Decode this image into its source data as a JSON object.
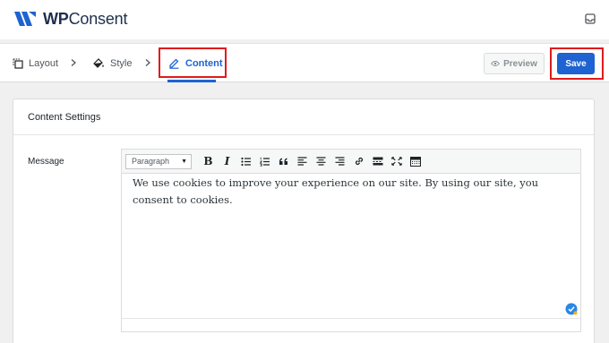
{
  "brand": {
    "name_bold": "WP",
    "name_regular": "Consent",
    "logo_color": "#1e63d1"
  },
  "header": {
    "icon": "inbox-icon"
  },
  "wizard": {
    "steps": [
      {
        "label": "Layout",
        "icon": "layout-icon"
      },
      {
        "label": "Style",
        "icon": "paint-bucket-icon"
      },
      {
        "label": "Content",
        "icon": "pencil-icon",
        "active": true
      }
    ],
    "preview_label": "Preview",
    "save_label": "Save"
  },
  "panel": {
    "title": "Content Settings",
    "message_label": "Message"
  },
  "editor": {
    "format_select": "Paragraph",
    "toolbar_icons": [
      "bold-icon",
      "italic-icon",
      "bulleted-list-icon",
      "numbered-list-icon",
      "blockquote-icon",
      "align-left-icon",
      "align-center-icon",
      "align-right-icon",
      "link-icon",
      "read-more-icon",
      "fullscreen-icon",
      "toolbar-toggle-icon"
    ],
    "content_line1": "We use cookies to improve your experience on our site. By using our site, you",
    "content_line2": "consent to cookies."
  },
  "colors": {
    "accent": "#1e63d1",
    "highlight_box": "#e01b1b"
  }
}
